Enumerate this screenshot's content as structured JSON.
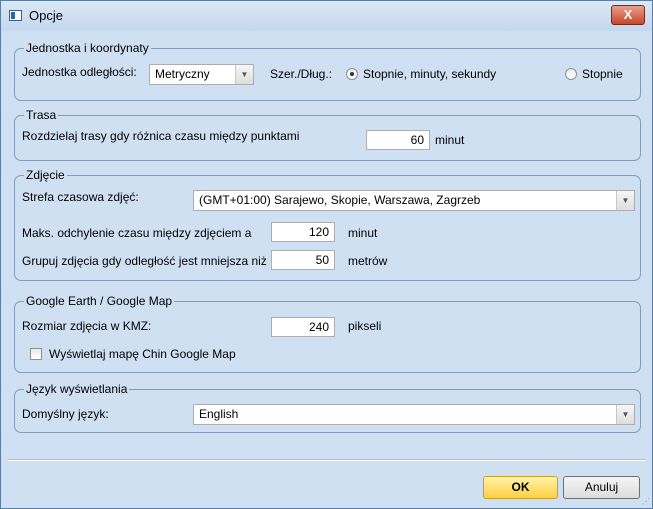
{
  "window": {
    "title": "Opcje",
    "close_glyph": "X"
  },
  "units": {
    "legend": "Jednostka i koordynaty",
    "distance_label": "Jednostka odległości:",
    "distance_value": "Metryczny",
    "coord_label": "Szer./Dług.:",
    "options": [
      {
        "label": "Stopnie, minuty, sekundy",
        "checked": true
      },
      {
        "label": "Stopnie",
        "checked": false
      }
    ]
  },
  "route": {
    "legend": "Trasa",
    "split_label": "Rozdzielaj trasy gdy różnica czasu między punktami",
    "split_value": "60",
    "split_unit": "minut"
  },
  "photo": {
    "legend": "Zdjęcie",
    "tz_label": "Strefa czasowa zdjęć:",
    "tz_value": "(GMT+01:00) Sarajewo, Skopie, Warszawa, Zagrzeb",
    "maxdev_label": "Maks. odchylenie czasu między zdjęciem a",
    "maxdev_value": "120",
    "maxdev_unit": "minut",
    "group_label": "Grupuj zdjęcia gdy odległość jest mniejsza niż",
    "group_value": "50",
    "group_unit": "metrów"
  },
  "google": {
    "legend": "Google Earth / Google Map",
    "size_label": "Rozmiar zdjęcia w KMZ:",
    "size_value": "240",
    "size_unit": "pikseli",
    "china_label": "Wyświetlaj mapę Chin Google Map",
    "china_checked": false
  },
  "language": {
    "legend": "Język wyświetlania",
    "default_label": "Domyślny język:",
    "default_value": "English"
  },
  "buttons": {
    "ok": "OK",
    "cancel": "Anuluj"
  },
  "colors": {
    "ok_button": "#ffcf45",
    "close_button": "#c9462c",
    "background": "#cfe0f2"
  }
}
